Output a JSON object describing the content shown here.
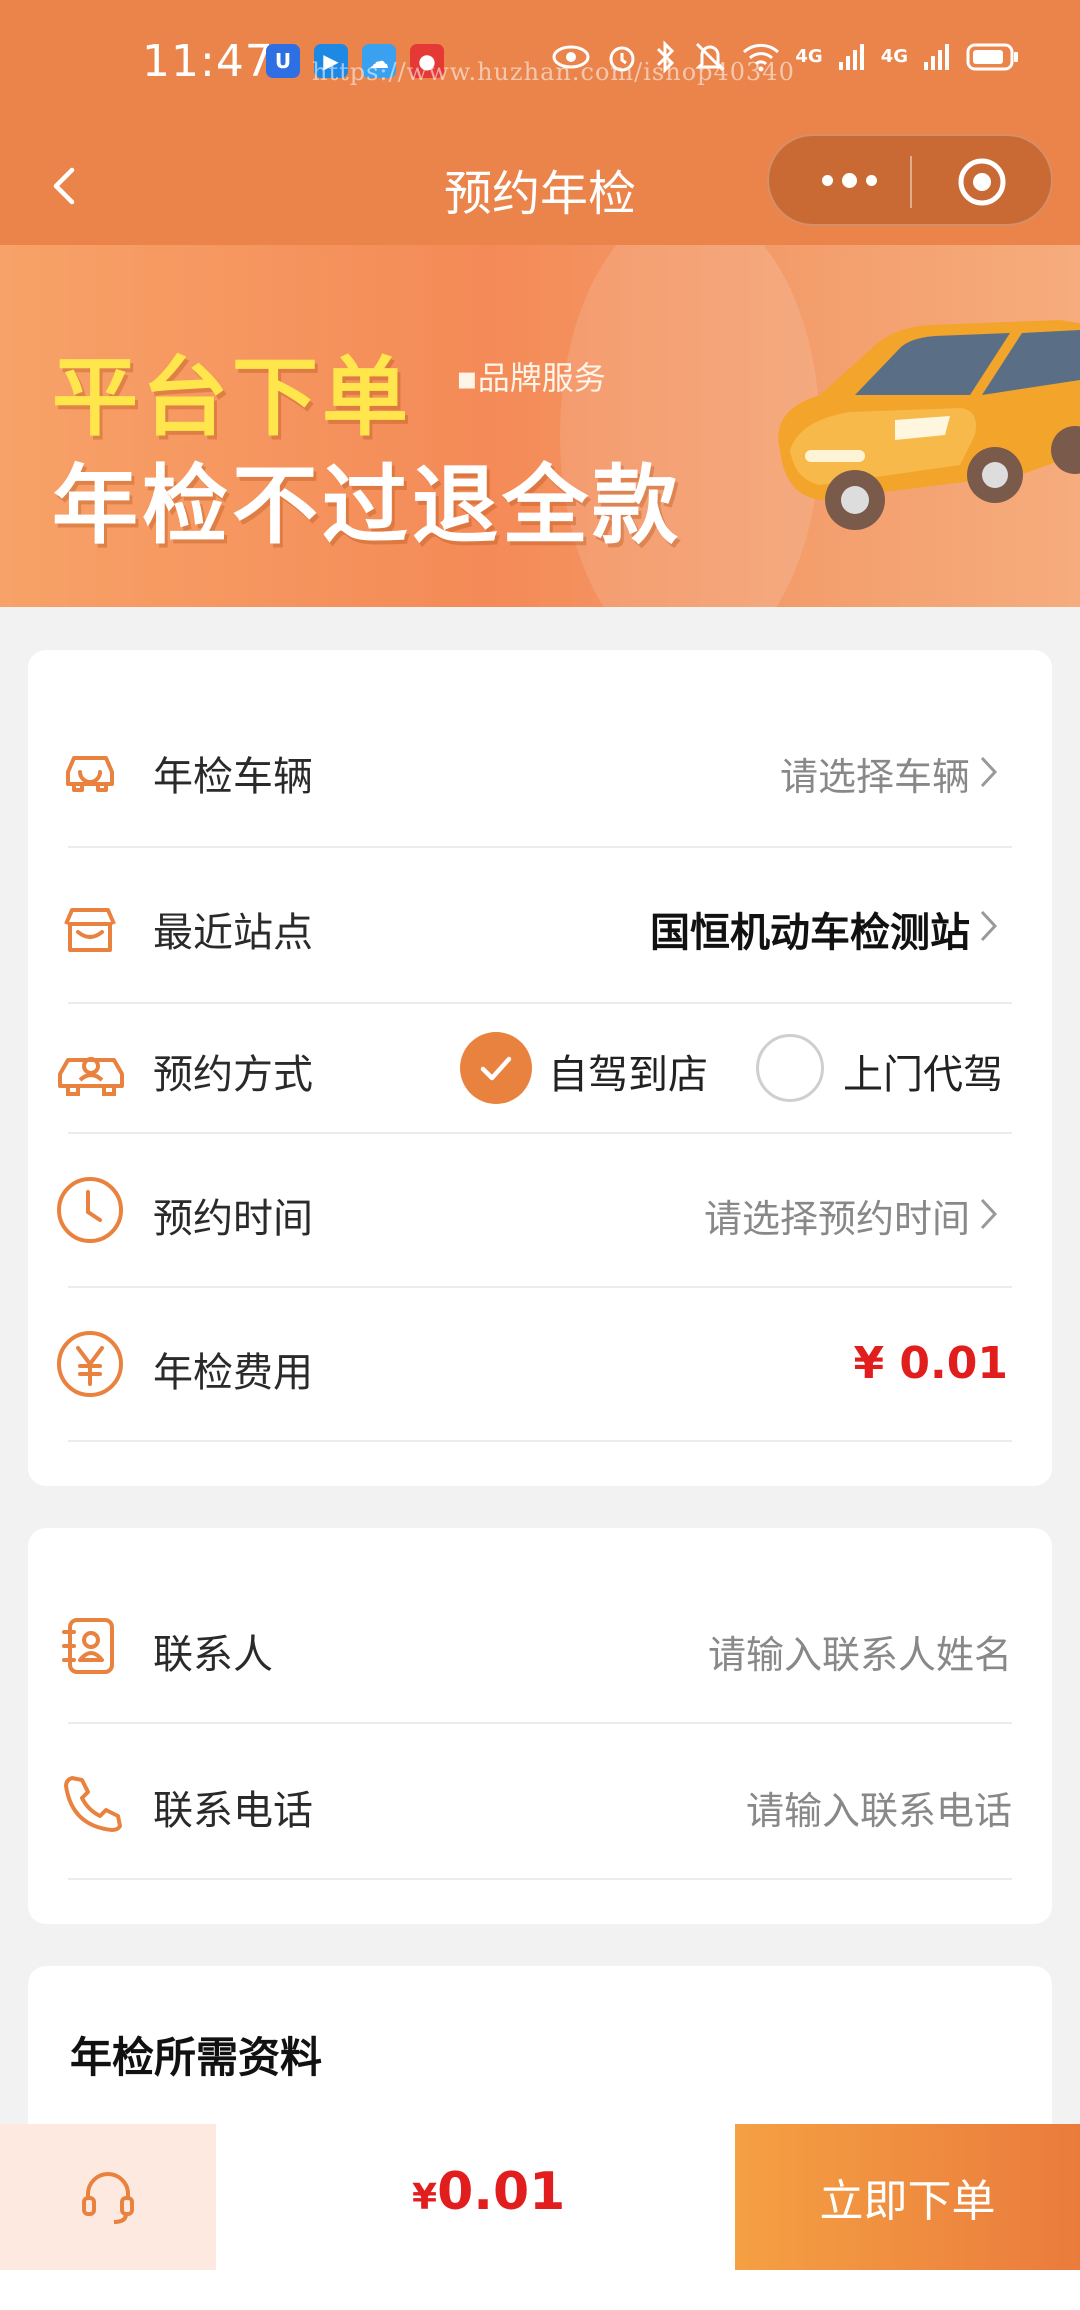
{
  "status_bar": {
    "time": "11:47",
    "watermark": "https://www.huzhan.com/ishop40340",
    "network_1": "4G",
    "network_2": "4G",
    "app_icons": [
      "u-app-icon",
      "blue-app-icon",
      "weather-app-icon",
      "red-app-icon"
    ]
  },
  "nav": {
    "title": "预约年检",
    "back_icon": "chevron-left-icon",
    "more_icon": "more-dots-icon",
    "close_icon": "target-close-icon"
  },
  "banner": {
    "line1": "平台下单",
    "tag": "▪品牌服务",
    "line2": "年检不过退全款"
  },
  "form": {
    "vehicle": {
      "label": "年检车辆",
      "value": "请选择车辆",
      "icon": "car-front-icon"
    },
    "station": {
      "label": "最近站点",
      "value": "国恒机动车检测站",
      "icon": "store-icon"
    },
    "method": {
      "label": "预约方式",
      "icon": "car-driver-icon",
      "options": [
        {
          "label": "自驾到店",
          "selected": true
        },
        {
          "label": "上门代驾",
          "selected": false
        }
      ]
    },
    "time": {
      "label": "预约时间",
      "value": "请选择预约时间",
      "icon": "clock-icon"
    },
    "fee": {
      "label": "年检费用",
      "value": "¥ 0.01",
      "icon": "yen-icon"
    }
  },
  "contact": {
    "name": {
      "label": "联系人",
      "placeholder": "请输入联系人姓名",
      "icon": "contact-book-icon"
    },
    "phone": {
      "label": "联系电话",
      "placeholder": "请输入联系电话",
      "icon": "phone-icon"
    }
  },
  "materials": {
    "title": "年检所需资料"
  },
  "bottom": {
    "service_icon": "headset-icon",
    "price_symbol": "¥",
    "price": "0.01",
    "submit": "立即下单"
  },
  "colors": {
    "brand": "#ea844a",
    "accent": "#e9813f",
    "price": "#e11d1d"
  }
}
